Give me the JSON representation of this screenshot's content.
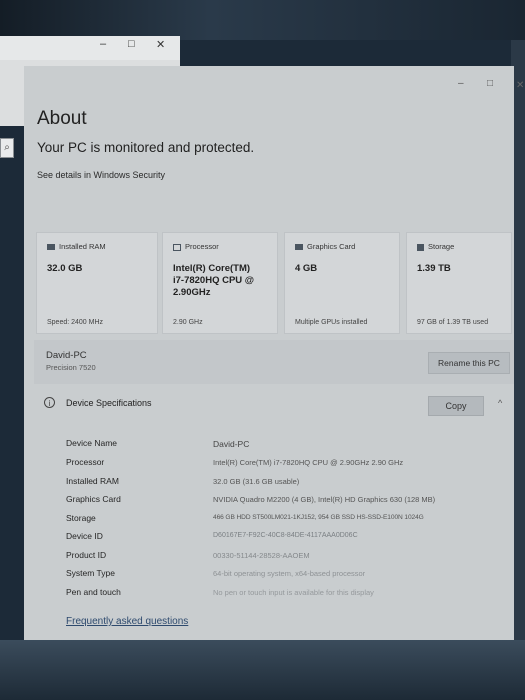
{
  "background_window": {
    "minimize": "–",
    "maximize": "□",
    "close": "✕"
  },
  "window": {
    "minimize": "–",
    "maximize": "□",
    "close": "✕"
  },
  "search_glyph": "⌕",
  "page": {
    "title": "About",
    "status": "Your PC is monitored and protected.",
    "security_link": "See details in Windows Security"
  },
  "cards": {
    "ram": {
      "label": "Installed RAM",
      "value": "32.0 GB",
      "foot": "Speed: 2400 MHz"
    },
    "processor": {
      "label": "Processor",
      "value_lines": [
        "Intel(R) Core(TM)",
        "i7-7820HQ CPU @",
        "2.90GHz"
      ],
      "foot": "2.90 GHz"
    },
    "graphics": {
      "label": "Graphics Card",
      "value": "4 GB",
      "foot": "Multiple GPUs installed"
    },
    "storage": {
      "label": "Storage",
      "value": "1.39 TB",
      "foot": "97 GB of 1.39 TB used"
    }
  },
  "pc": {
    "name": "David-PC",
    "model": "Precision 7520",
    "rename_label": "Rename this PC"
  },
  "specs": {
    "title": "Device Specifications",
    "copy_label": "Copy",
    "info_glyph": "i",
    "chevron": "^",
    "rows": [
      {
        "label": "Device Name",
        "value": "David-PC"
      },
      {
        "label": "Processor",
        "value": "Intel(R) Core(TM) i7-7820HQ CPU @ 2.90GHz   2.90 GHz"
      },
      {
        "label": "Installed RAM",
        "value": "32.0 GB (31.6 GB usable)"
      },
      {
        "label": "Graphics Card",
        "value": "NVIDIA Quadro M2200 (4 GB), Intel(R) HD Graphics 630 (128 MB)"
      },
      {
        "label": "Storage",
        "value": "466 GB HDD ST500LM021-1KJ152, 954 GB SSD HS-SSD-E100N 1024G"
      },
      {
        "label": "Device ID",
        "value": "D60167E7-F92C-40C8-84DE-4117AAA0D06C"
      },
      {
        "label": "Product ID",
        "value": "00330-51144-28528-AAOEM"
      },
      {
        "label": "System Type",
        "value": "64-bit operating system, x64-based processor"
      },
      {
        "label": "Pen and touch",
        "value": "No pen or touch input is available for this display"
      }
    ]
  },
  "faq_link": "Frequently asked questions"
}
